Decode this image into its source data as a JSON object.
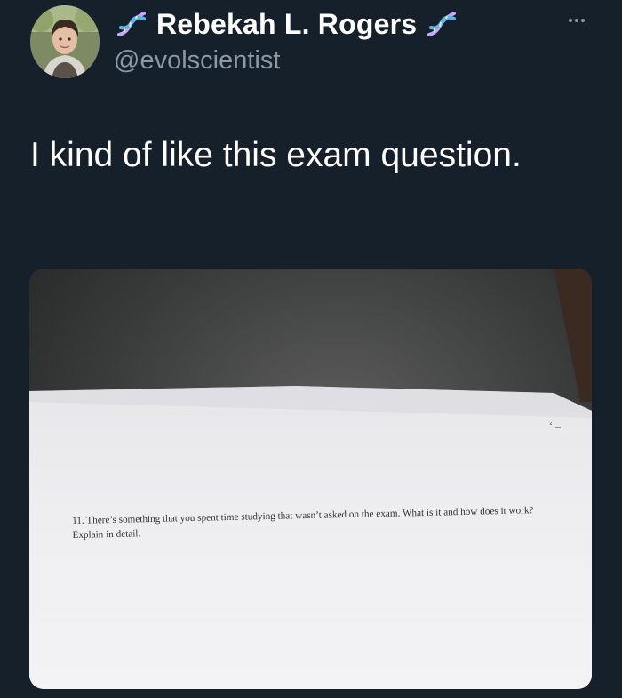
{
  "author": {
    "display_name": "Rebekah L. Rogers",
    "handle": "@evolscientist",
    "name_emoji_icon": "dna-icon"
  },
  "tweet": {
    "text": "I kind of like this exam question."
  },
  "menu": {
    "icon": "more-icon"
  },
  "media": {
    "exam_question_text": "11.  There’s something that you spent time studying that wasn’t asked on the exam.  What is it and how does it work?  Explain in detail."
  },
  "colors": {
    "background": "#15202b",
    "text_primary": "#ffffff",
    "text_secondary": "#8b98a5"
  }
}
